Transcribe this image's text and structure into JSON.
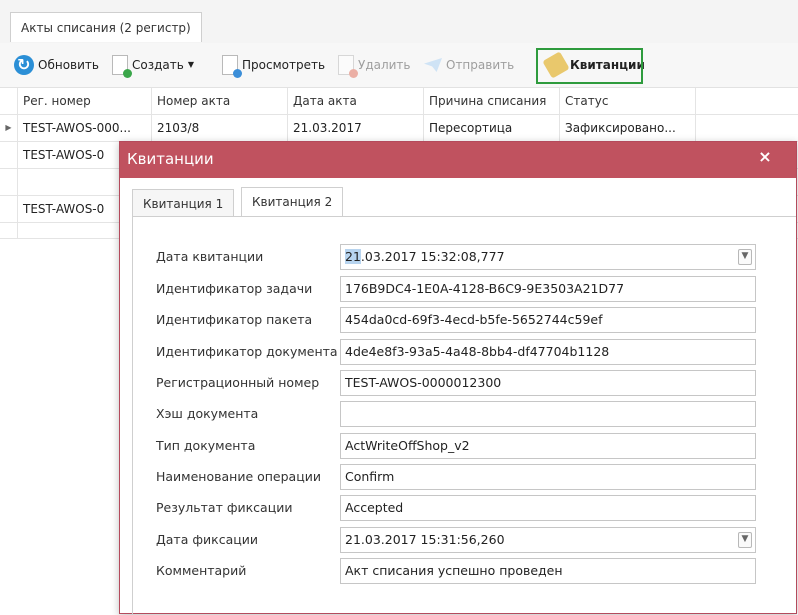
{
  "document_tab": "Акты списания (2 регистр)",
  "toolbar": {
    "refresh": "Обновить",
    "create": "Создать",
    "view": "Просмотреть",
    "delete": "Удалить",
    "send": "Отправить",
    "receipts": "Квитанции"
  },
  "grid": {
    "columns": [
      "Рег. номер",
      "Номер акта",
      "Дата акта",
      "Причина списания",
      "Статус"
    ],
    "rows": [
      [
        "TEST-AWOS-000...",
        "2103/8",
        "21.03.2017",
        "Пересортица",
        "Зафиксировано..."
      ],
      [
        "TEST-AWOS-0",
        "",
        "",
        "",
        ""
      ],
      [
        "TEST-AWOS-0",
        "",
        "",
        "",
        ""
      ]
    ]
  },
  "modal": {
    "title": "Квитанции",
    "close": "×",
    "tabs": [
      "Квитанция 1",
      "Квитанция 2"
    ],
    "active_tab": "Квитанция 2",
    "fields": [
      {
        "label": "Дата квитанции",
        "value_highlight": "21",
        "value_rest": ".03.2017 15:32:08,777",
        "dropdown": true
      },
      {
        "label": "Идентификатор задачи",
        "value": "176B9DC4-1E0A-4128-B6C9-9E3503A21D77"
      },
      {
        "label": "Идентификатор пакета",
        "value": "454da0cd-69f3-4ecd-b5fe-5652744c59ef"
      },
      {
        "label": "Идентификатор документа",
        "value": "4de4e8f3-93a5-4a48-8bb4-df47704b1128"
      },
      {
        "label": "Регистрационный номер",
        "value": "TEST-AWOS-0000012300"
      },
      {
        "label": "Хэш документа",
        "value": ""
      },
      {
        "label": "Тип документа",
        "value": "ActWriteOffShop_v2"
      },
      {
        "label": "Наименование операции",
        "value": "Confirm"
      },
      {
        "label": "Результат фиксации",
        "value": "Accepted"
      },
      {
        "label": "Дата фиксации",
        "value": "21.03.2017 15:31:56,260",
        "dropdown": true
      },
      {
        "label": "Комментарий",
        "value": "Акт списания успешно проведен"
      }
    ]
  },
  "colors": {
    "modal_header": "#c0525f",
    "highlight_border": "#2e9b3d",
    "refresh_icon": "#2b8fd6"
  },
  "icons": {
    "refresh": "refresh-icon",
    "create": "new-document-icon",
    "view": "view-document-icon",
    "delete": "delete-document-icon",
    "send": "send-icon",
    "receipts": "tag-icon",
    "dropdown": "chevron-down-icon",
    "close": "close-icon"
  }
}
